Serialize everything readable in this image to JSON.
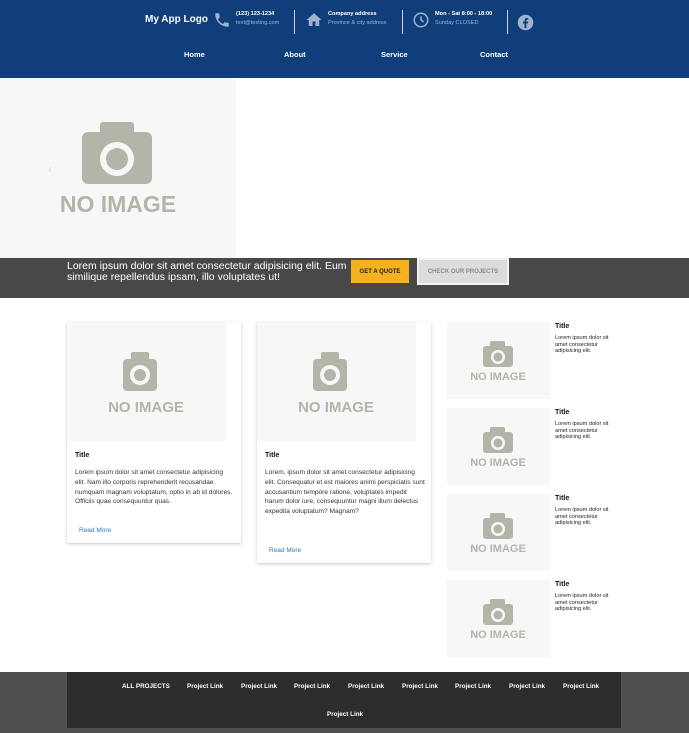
{
  "header": {
    "logo": "My App Logo",
    "phone": {
      "line1": "(123) 123-1234",
      "line2": "text@testing.com"
    },
    "address": {
      "line1": "Company address",
      "line2": "Province & city address"
    },
    "hours": {
      "line1": "Mon - Sat 8:00 - 18:00",
      "line2": "Sunday CLOSED"
    },
    "nav": [
      "Home",
      "About",
      "Service",
      "Contact"
    ]
  },
  "no_image_label": "NO IMAGE",
  "banner": {
    "text": "Lorem ipsum dolor sit amet consectetur adipisicing elit. Eum similique repellendus ipsam, illo voluptates ut!",
    "quote_button": "GET A QUOTE",
    "projects_button": "CHECK OUR PROJECTS"
  },
  "cards": [
    {
      "title": "Title",
      "body": "Lorem ipsum dolor sit amet consectetur adipisicing elit. Nam illo corporis reprehenderit recusandae numquam magnam voluptatum, optio in ab id dolores. Officiis quae consequuntur quas.",
      "link": "Read More"
    },
    {
      "title": "Title",
      "body": "Lorem, ipsum dolor sit amet consectetur adipisicing elit. Consequatur et est maiores animi perspiciatis sunt accusantium tempore ratione, voluptates impedit harum dolor iure, consequuntur magni illum delectus expedita voluptatum? Magnam?",
      "link": "Read More"
    }
  ],
  "side_items": [
    {
      "title": "Title",
      "body": "Lorem ipsum dolor sit amet consectetur adipisicing elit."
    },
    {
      "title": "Title",
      "body": "Lorem ipsum dolor sit amet consectetur adipisicing elit."
    },
    {
      "title": "Title",
      "body": "Lorem ipsum dolor sit amet consectetur adipisicing elit."
    },
    {
      "title": "Title",
      "body": "Lorem ipsum dolor sit amet consectetur adipisicing elit."
    }
  ],
  "footer": {
    "links": [
      "ALL PROJECTS",
      "Project Link",
      "Project Link",
      "Project Link",
      "Project Link",
      "Project Link",
      "Project Link",
      "Project Link",
      "Project Link",
      "Project Link"
    ]
  },
  "colors": {
    "header": "#0f3e7a",
    "accent": "#f5b21e",
    "banner": "#484848",
    "footer": "#2d2d2d",
    "link": "#2e7ab8"
  },
  "icons": [
    "phone-icon",
    "home-icon",
    "clock-icon",
    "facebook-icon",
    "camera-icon",
    "chevron-left-icon"
  ]
}
